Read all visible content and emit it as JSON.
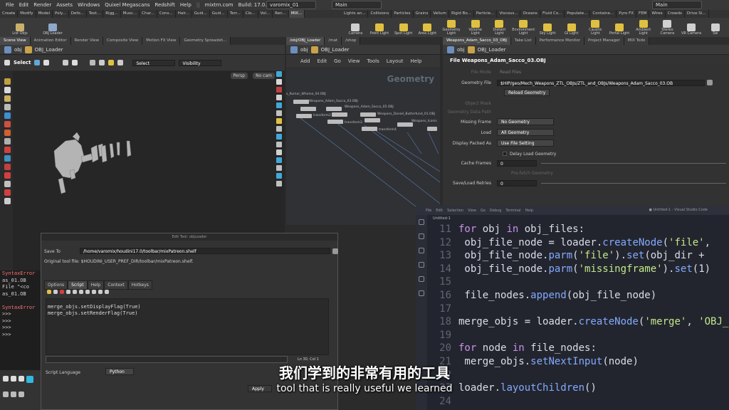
{
  "menubar": {
    "items": [
      "File",
      "Edit",
      "Render",
      "Assets",
      "Windows",
      "Quixel Megascans",
      "Redshift",
      "Help"
    ],
    "site": "mixtrn.com",
    "build": "Build: 17.0.497",
    "desktop": "varomix_01",
    "main_left": "Main",
    "main_right": "Main"
  },
  "shelf_left": {
    "tabs": [
      "Create",
      "Modify",
      "Model",
      "Poly...",
      "Defo...",
      "Text...",
      "Rigg...",
      "Musc...",
      "Char...",
      "Cons...",
      "Hair...",
      "Guid...",
      "Guid...",
      "Terr...",
      "Clo...",
      "Vol...",
      "Ren...",
      "MIX..."
    ],
    "tools": [
      "List Objs",
      "OBJ Loader"
    ]
  },
  "shelf_right": {
    "tabs": [
      "Lights an...",
      "Collisions",
      "Particles",
      "Grains",
      "Vellum",
      "Rigid Bo...",
      "Particle...",
      "Viscous...",
      "Oceans",
      "Fluid Co...",
      "Populate...",
      "Containe...",
      "Pyro FX",
      "FEM",
      "Wires",
      "Crowds",
      "Drive Si..."
    ],
    "tools": [
      "Camera",
      "Point Light",
      "Spot Light",
      "Area Light",
      "Geometry Light",
      "Volume Light",
      "Distant Light",
      "Environment Light",
      "Sky Light",
      "GI Light",
      "Caustic Light",
      "Portal Light",
      "Ambient Light",
      "Stereo Camera",
      "VR Camera",
      "Sw"
    ]
  },
  "scene_pane": {
    "tabs": [
      "Scene View",
      "Animation Editor",
      "Render View",
      "Composite View",
      "Motion FX View",
      "Geometry Spreadsh..."
    ],
    "path": [
      "obj",
      "OBJ_Loader"
    ],
    "select_label": "Select",
    "select_dropdown": "Select",
    "visibility_dropdown": "Visibility",
    "persp": "Persp",
    "cam": "No cam"
  },
  "network_pane": {
    "tabs": [
      "/obj/OBJ_Loader",
      "/mat",
      "/shop"
    ],
    "path": [
      "obj",
      "OBJ_Loader"
    ],
    "menu": [
      "Add",
      "Edit",
      "Go",
      "View",
      "Tools",
      "Layout",
      "Help"
    ],
    "context_label": "Geometry",
    "nodes": [
      "s_Kumar_Whaine_04.OBJ",
      "Weapons_Adam_Sacco_03.OBJ",
      "Weapons_Adam_Sacco_05.OBJ",
      "Weapons_Daniel_Butterfund_01.OBJ",
      "Weapons_Iconis",
      "transform2",
      "transform3",
      "transform4"
    ]
  },
  "param_pane": {
    "tabs": [
      "Weapons_Adam_Sacco_03_OBJ",
      "Take List",
      "Performance Monitor",
      "Project Manager",
      "MIX Todo"
    ],
    "path": [
      "obj",
      "OBJ_Loader"
    ],
    "node_header": "File  Weapons_Adam_Sacco_03.OBJ",
    "file_mode": "File Mode",
    "file_mode_value": "Read Files",
    "geometry_file_label": "Geometry File",
    "geometry_file_value": "$HIP/geo/Mech_Weapons_ZTL_OBJs/ZTL_and_OBJs/Weapons_Adam_Sacco_03.OB",
    "reload_button": "Reload Geometry",
    "object_mask": "Object Mask",
    "geometry_data_path": "Geometry Data Path",
    "missing_frame_label": "Missing Frame",
    "missing_frame_value": "No Geometry",
    "load_label": "Load",
    "load_value": "All Geometry",
    "display_packed_label": "Display Packed As",
    "display_packed_value": "Use File Setting",
    "delay_load": "Delay Load Geometry",
    "cache_frames_label": "Cache Frames",
    "cache_frames_value": "0",
    "prefetch": "Pre-fetch Geometry",
    "retries_label": "Save/Load Retries",
    "retries_value": "0"
  },
  "console": {
    "lines": [
      "SyntaxError",
      "as_01.OB",
      "File \"<co",
      "as_01.OB",
      "",
      "SyntaxError",
      ">>>",
      ">>>",
      ">>>",
      ">>>"
    ],
    "prompt": ">>>"
  },
  "dialog": {
    "title": "Edit Tool: objLoader",
    "save_to_label": "Save To",
    "save_to_value": "/home/varomix/houdini17.0/toolbar/mixPatreon.shelf",
    "original_label": "Original tool file: $HOUDINI_USER_PREF_DIR/toolbar/mixPatreon.shelf.",
    "tabs": [
      "Options",
      "Script",
      "Help",
      "Context",
      "Hotkeys"
    ],
    "script_lines": [
      "merge_objs.setDisplayFlag(True)",
      "merge_objs.setRenderFlag(True)"
    ],
    "cursor_pos": "Ln 30, Col 1",
    "lang_label": "Script Language",
    "lang_value": "Python",
    "apply_button": "Apply"
  },
  "vscode": {
    "title": "● Untitled-1 - Visual Studio Code",
    "menu": [
      "File",
      "Edit",
      "Selection",
      "View",
      "Go",
      "Debug",
      "Terminal",
      "Help"
    ],
    "tab": "Untitled-1",
    "lines": [
      {
        "n": "11",
        "parts": [
          [
            "kw",
            "for"
          ],
          [
            "tx",
            " obj "
          ],
          [
            "kw",
            "in"
          ],
          [
            "tx",
            " obj_files:"
          ]
        ]
      },
      {
        "n": "12",
        "parts": [
          [
            "tx",
            "    obj_file_node = loader."
          ],
          [
            "fn",
            "createNode"
          ],
          [
            "tx",
            "("
          ],
          [
            "st",
            "'file'"
          ],
          [
            "tx",
            ","
          ]
        ]
      },
      {
        "n": "13",
        "parts": [
          [
            "tx",
            "    obj_file_node."
          ],
          [
            "fn",
            "parm"
          ],
          [
            "tx",
            "("
          ],
          [
            "st",
            "'file'"
          ],
          [
            "tx",
            ")."
          ],
          [
            "fn",
            "set"
          ],
          [
            "tx",
            "(obj_dir +"
          ]
        ]
      },
      {
        "n": "14",
        "parts": [
          [
            "tx",
            "    obj_file_node."
          ],
          [
            "fn",
            "parm"
          ],
          [
            "tx",
            "("
          ],
          [
            "st",
            "'missingframe'"
          ],
          [
            "tx",
            ")."
          ],
          [
            "fn",
            "set"
          ],
          [
            "tx",
            "(1)"
          ]
        ]
      },
      {
        "n": "15",
        "parts": []
      },
      {
        "n": "16",
        "parts": [
          [
            "tx",
            "    file_nodes."
          ],
          [
            "fn",
            "append"
          ],
          [
            "tx",
            "(obj_file_node)"
          ]
        ]
      },
      {
        "n": "17",
        "parts": []
      },
      {
        "n": "18",
        "parts": [
          [
            "tx",
            "merge_objs = loader."
          ],
          [
            "fn",
            "createNode"
          ],
          [
            "tx",
            "("
          ],
          [
            "st",
            "'merge'"
          ],
          [
            "tx",
            ", "
          ],
          [
            "st",
            "'OBJ_"
          ]
        ]
      },
      {
        "n": "19",
        "parts": []
      },
      {
        "n": "20",
        "parts": [
          [
            "kw",
            "for"
          ],
          [
            "tx",
            " node "
          ],
          [
            "kw",
            "in"
          ],
          [
            "tx",
            " file_nodes:"
          ]
        ]
      },
      {
        "n": "21",
        "parts": [
          [
            "tx",
            "    merge_objs."
          ],
          [
            "fn",
            "setNextInput"
          ],
          [
            "tx",
            "(node)"
          ]
        ]
      },
      {
        "n": "22",
        "parts": []
      },
      {
        "n": "23",
        "parts": [
          [
            "tx",
            "loader."
          ],
          [
            "fn",
            "layoutChildren"
          ],
          [
            "tx",
            "()"
          ]
        ]
      },
      {
        "n": "24",
        "parts": []
      }
    ]
  },
  "subtitle": {
    "zh": "我们学到的非常有用的工具",
    "en": "tool that is really useful we learned"
  }
}
